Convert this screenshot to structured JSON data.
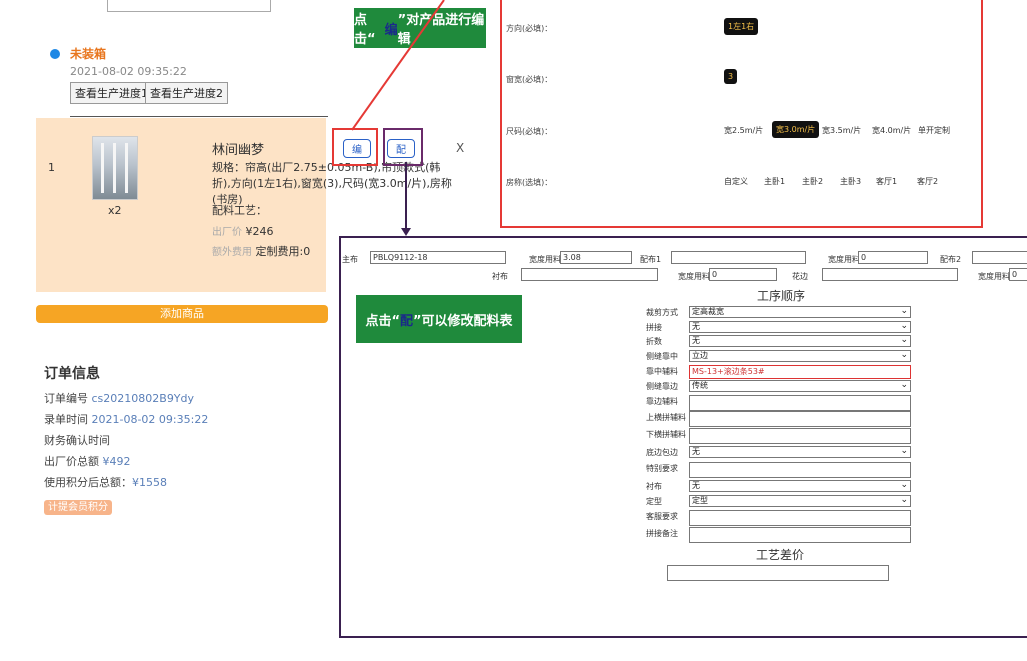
{
  "top_left": {
    "status": "未装箱",
    "status_time": "2021-08-02 09:35:22",
    "progress_btn1": "查看生产进度1",
    "progress_btn2": "查看生产进度2"
  },
  "product": {
    "index": "1",
    "qty": "x2",
    "name": "林间幽梦",
    "spec": "规格：帘高(出厂2.75±0.05m-B),帘顶款式(韩折),方向(1左1右),窗宽(3),尺码(宽3.0m/片),房称(书房)",
    "craft": "配料工艺：",
    "factory_label": "出厂价",
    "factory_price": "¥246",
    "extra_label": "额外费用",
    "extra_value": "定制费用:0",
    "edit_btn": "编",
    "match_btn": "配",
    "close": "X",
    "add_product": "添加商品"
  },
  "order": {
    "title": "订单信息",
    "no_label": "订单编号",
    "no": "cs20210802B9Ydy",
    "time_label": "录单时间",
    "time": "2021-08-02 09:35:22",
    "confirm": "财务确认时间",
    "total_label": "出厂价总额",
    "total": "¥492",
    "points_label": "使用积分后总额：",
    "points": "¥1558",
    "points_tag": "计提会员积分"
  },
  "callouts": {
    "edit_pre": "点击“",
    "edit_hl": "编",
    "edit_post": "”对产品进行编辑",
    "match_pre": "点击“",
    "match_hl": "配",
    "match_post": "”可以修改配料表"
  },
  "right_panel": {
    "rows": [
      {
        "label": "方向(必填)：",
        "options": [
          {
            "text": "1左1右",
            "selected": true
          }
        ]
      },
      {
        "label": "窗宽(必填)：",
        "options": [
          {
            "text": "3",
            "selected": true
          }
        ]
      },
      {
        "label": "尺码(必填)：",
        "options": [
          {
            "text": "宽2.5m/片",
            "selected": false
          },
          {
            "text": "宽3.0m/片",
            "selected": true
          },
          {
            "text": "宽3.5m/片",
            "selected": false
          },
          {
            "text": "宽4.0m/片",
            "selected": false
          },
          {
            "text": "单开定制",
            "selected": false
          }
        ]
      },
      {
        "label": "房称(选填)：",
        "options": [
          {
            "text": "自定义",
            "selected": false
          },
          {
            "text": "主卧1",
            "selected": false
          },
          {
            "text": "主卧2",
            "selected": false
          },
          {
            "text": "主卧3",
            "selected": false
          },
          {
            "text": "客厅1",
            "selected": false
          },
          {
            "text": "客厅2",
            "selected": false
          }
        ]
      }
    ]
  },
  "material": {
    "zhubu": "主布",
    "zhubu_value": "PBLQ9112-18",
    "kuandu1": "宽度用料",
    "kuandu1_value": "3.08",
    "peibu1": "配布1",
    "kuandu2": "宽度用料",
    "kuandu2_value": "0",
    "peibu2": "配布2",
    "chenbu": "衬布",
    "kuandu3": "宽度用料",
    "kuandu3_value": "0",
    "huabian": "花边",
    "kuandu4": "宽度用料",
    "kuandu4_value": "0"
  },
  "process": {
    "title": "工序顺序",
    "rows": [
      {
        "label": "裁剪方式",
        "value": "定高裁宽",
        "kind": "select"
      },
      {
        "label": "拼接",
        "value": "无",
        "kind": "select"
      },
      {
        "label": "折数",
        "value": "无",
        "kind": "select"
      },
      {
        "label": "侧缝靠中",
        "value": "立边",
        "kind": "select"
      },
      {
        "label": "靠中辅料",
        "value": "MS-13+滚边条53#",
        "kind": "input-red"
      },
      {
        "label": "侧缝靠边",
        "value": "传统",
        "kind": "select"
      },
      {
        "label": "靠边辅料",
        "value": "",
        "kind": "input"
      },
      {
        "label": "上横拼辅料",
        "value": "",
        "kind": "input"
      },
      {
        "label": "下横拼辅料",
        "value": "",
        "kind": "input"
      },
      {
        "label": "底边包边",
        "value": "无",
        "kind": "select"
      },
      {
        "label": "特别要求",
        "value": "",
        "kind": "input"
      },
      {
        "label": "衬布",
        "value": "无",
        "kind": "select"
      },
      {
        "label": "定型",
        "value": "定型",
        "kind": "select"
      },
      {
        "label": "客服要求",
        "value": "",
        "kind": "input"
      },
      {
        "label": "拼接备注",
        "value": "",
        "kind": "input"
      }
    ],
    "diff_title": "工艺差价"
  }
}
